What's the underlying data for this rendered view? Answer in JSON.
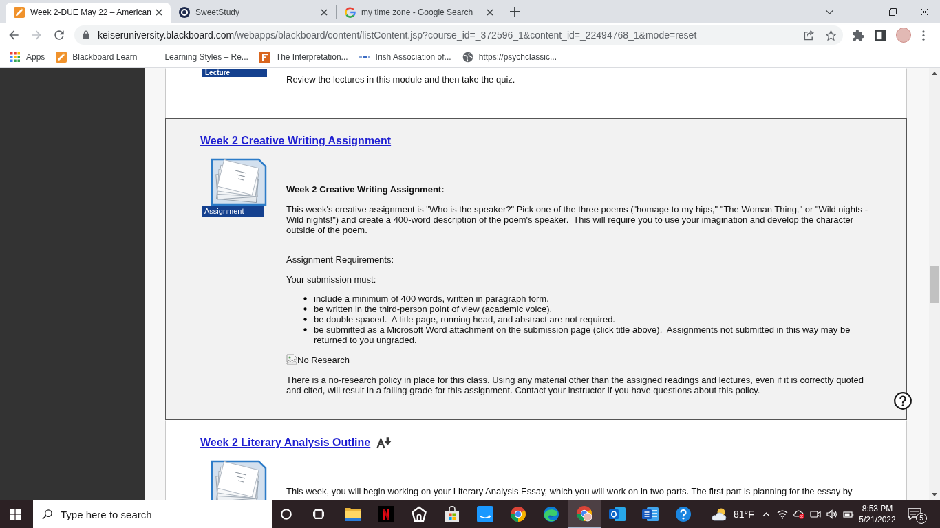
{
  "browser": {
    "tabs": [
      {
        "title": "Week 2-DUE May 22 – American",
        "selected": true
      },
      {
        "title": "SweetStudy",
        "selected": false
      },
      {
        "title": "my time zone - Google Search",
        "selected": false
      }
    ],
    "toolbar": {
      "back_disabled": false,
      "forward_disabled": true,
      "url_host": "keiseruniversity.blackboard.com",
      "url_path": "/webapps/blackboard/content/listContent.jsp?course_id=_372596_1&content_id=_22494768_1&mode=reset",
      "bookmarked": false
    },
    "bookmarks": [
      "Apps",
      "Blackboard Learn",
      "Learning Styles – Re...",
      "The Interpretation...",
      "Irish Association of...",
      "https://psychclassic..."
    ]
  },
  "content": {
    "items": [
      {
        "kind": "lecture",
        "icon_label": "Lecture",
        "highlighted": false,
        "body": [
          {
            "kind": "paragraph",
            "text": "Review the lectures in this module and then take the quiz."
          }
        ]
      },
      {
        "kind": "assignment",
        "title": "Week 2 Creative Writing Assignment",
        "icon_label": "Assignment",
        "highlighted": true,
        "alt_formats": false,
        "body": [
          {
            "kind": "heading",
            "text": "Week 2 Creative Writing Assignment:"
          },
          {
            "kind": "paragraph",
            "text": "This week's creative assignment is \"Who is the speaker?\" Pick one of the three poems (\"homage to my hips,\" \"The Woman Thing,\" or \"Wild nights - Wild nights!\") and create a 400-word description of the poem's speaker.  This will require you to use your imagination and develop the character outside of the poem."
          },
          {
            "kind": "subheading",
            "text": "Assignment Requirements:"
          },
          {
            "kind": "paragraph",
            "text": "Your submission must:"
          },
          {
            "kind": "list",
            "items": [
              "include a minimum of 400 words, written in paragraph form.",
              "be written in the third-person point of view (academic voice).",
              "be double spaced.  A title page, running head, and abstract are not required.",
              "be submitted as a Microsoft Word attachment on the submission page (click title above).  Assignments not submitted in this way may be returned to you ungraded."
            ]
          },
          {
            "kind": "image",
            "alt": "No Research"
          },
          {
            "kind": "paragraph",
            "text": "There is a no-research policy in place for this class. Using any material other than the assigned readings and lectures, even if it is correctly quoted and cited, will result in a failing grade for this assignment. Contact your instructor if you have questions about this policy."
          }
        ]
      },
      {
        "kind": "assignment",
        "title": "Week 2 Literary Analysis Outline",
        "highlighted": false,
        "alt_formats": true,
        "body": [
          {
            "kind": "paragraph",
            "text": "This week, you will begin working on your Literary Analysis Essay, which you will work on in two parts. The first part is planning for the essay by"
          }
        ]
      }
    ]
  },
  "taskbar": {
    "search": {
      "placeholder": "Type here to search"
    },
    "apps": [
      {
        "active": false
      },
      {
        "active": false
      },
      {
        "active": false
      },
      {
        "active": false
      },
      {
        "active": false
      },
      {
        "active": false
      },
      {
        "active": false
      },
      {
        "active": true
      },
      {
        "active": false
      },
      {
        "active": false
      },
      {
        "active": false
      }
    ],
    "weather": {
      "temperature": "81°F"
    },
    "clock": {
      "time": "8:53 PM",
      "date": "5/21/2022"
    },
    "notifications": {
      "count": "5"
    }
  }
}
